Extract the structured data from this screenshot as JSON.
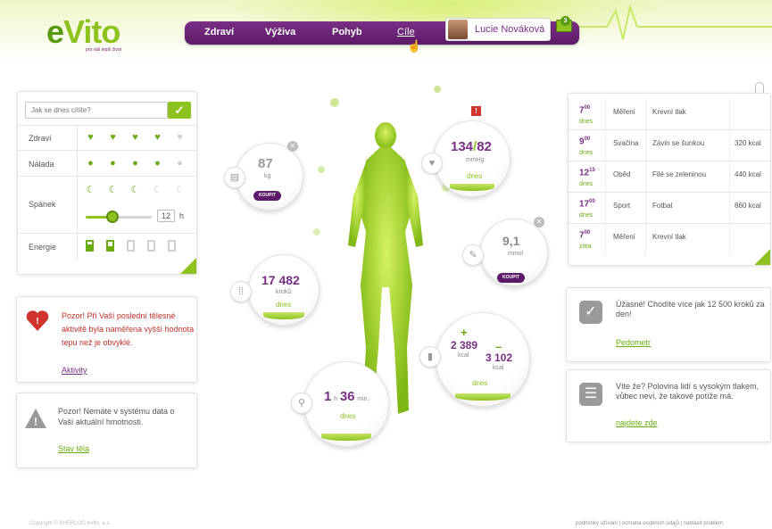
{
  "brand": {
    "logo": "eVito",
    "tagline": "pro váš lepší život"
  },
  "nav": {
    "items": [
      "Zdraví",
      "Výživa",
      "Pohyb",
      "Cíle"
    ],
    "active": "Cíle"
  },
  "user": {
    "name": "Lucie Nováková",
    "messages": "3"
  },
  "mood": {
    "placeholder": "Jak se dnes cítíte?",
    "rows": [
      {
        "label": "Zdraví",
        "on": 4,
        "total": 5
      },
      {
        "label": "Nálada",
        "on": 4,
        "total": 5
      },
      {
        "label": "Spánek",
        "on": 3,
        "total": 5
      },
      {
        "label": "Energie",
        "on": 2,
        "total": 5
      }
    ],
    "sleep_hours": "12",
    "sleep_unit": "h"
  },
  "alerts": {
    "activity": {
      "text": "Pozor! Při Vaší poslední tělesné aktivitě byla naměřena vyšší hodnota tepu než je obvyklé.",
      "link": "Aktivity"
    },
    "weight": {
      "text": "Pozor! Nemáte v systému data o Vaší aktuální hmotnosti.",
      "link": "Stav těla"
    }
  },
  "bubbles": {
    "weight": {
      "value": "87",
      "unit": "kg",
      "button": "KOUPIT"
    },
    "pressure": {
      "sys": "134",
      "dia": "82",
      "unit": "mmHg",
      "when": "dnes"
    },
    "glucose": {
      "value": "9,1",
      "unit": "mmol",
      "button": "KOUPIT"
    },
    "steps": {
      "value": "17 482",
      "unit": "kroků",
      "when": "dnes"
    },
    "calories": {
      "plus_sign": "+",
      "plus": "2 389",
      "plus_unit": "kcal",
      "minus_sign": "–",
      "minus": "3 102",
      "minus_unit": "kcal",
      "when": "dnes"
    },
    "cycling": {
      "hours": "1",
      "h": "h",
      "minutes": "36",
      "min": "min.",
      "when": "dnes"
    }
  },
  "schedule": [
    {
      "time": "7",
      "min": "00",
      "day": "dnes",
      "type": "Měření",
      "name": "Krevní tlak",
      "kcal": ""
    },
    {
      "time": "9",
      "min": "00",
      "day": "dnes",
      "type": "Svačina",
      "name": "Závin se šunkou",
      "kcal": "320 kcal"
    },
    {
      "time": "12",
      "min": "15",
      "day": "dnes",
      "type": "Oběd",
      "name": "Filé se zeleninou",
      "kcal": "440 kcal"
    },
    {
      "time": "17",
      "min": "00",
      "day": "dnes",
      "type": "Sport",
      "name": "Fotbal",
      "kcal": "860 kcal"
    },
    {
      "time": "7",
      "min": "00",
      "day": "zítra",
      "type": "Měření",
      "name": "Krevní tlak",
      "kcal": ""
    }
  ],
  "info": {
    "pedometer": {
      "text": "Úžasné! Chodíte více jak 12 500 kroků za den!",
      "link": "Pedometr"
    },
    "pressure": {
      "text": "Víte že? Polovina lidí s vysokým tlakem, vůbec neví, že takové potíže má.",
      "link": "najdete zde"
    }
  },
  "footer": {
    "copyright": "Copyright © SHERLOG eVito, a.s.",
    "links": "podmínky užívání | ochrana osobních údajů | nahlásit problém"
  },
  "colors": {
    "purple": "#7a2f86",
    "green": "#8dc21f",
    "red": "#c0302a"
  }
}
